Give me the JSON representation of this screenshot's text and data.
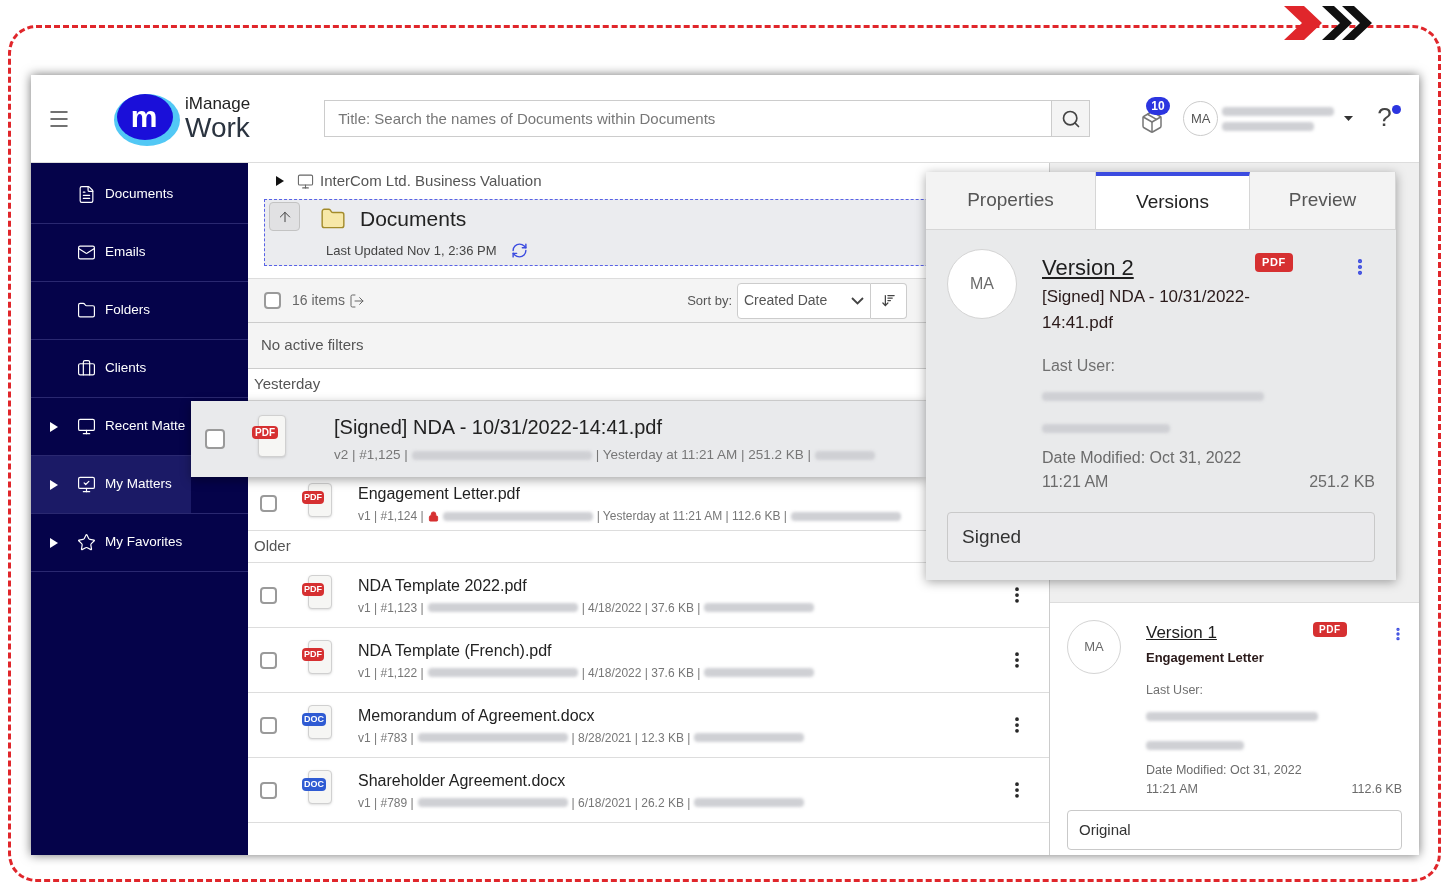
{
  "header": {
    "logo": {
      "mark": "m",
      "brand": "iManage",
      "product": "Work"
    },
    "search": {
      "placeholder": "Title: Search the names of Documents within Documents"
    },
    "notifications": "10",
    "avatar": "MA",
    "help": "?",
    "help_dot": true
  },
  "sidebar": {
    "items": [
      {
        "label": "Documents",
        "expandable": false,
        "selected": false
      },
      {
        "label": "Emails",
        "expandable": false,
        "selected": false
      },
      {
        "label": "Folders",
        "expandable": false,
        "selected": false
      },
      {
        "label": "Clients",
        "expandable": false,
        "selected": false
      },
      {
        "label": "Recent Matte",
        "expandable": true,
        "selected": false
      },
      {
        "label": "My Matters",
        "expandable": true,
        "selected": true
      },
      {
        "label": "My Favorites",
        "expandable": true,
        "selected": false
      }
    ]
  },
  "breadcrumb": "InterCom Ltd. Business Valuation",
  "folder": {
    "title": "Documents",
    "updated": "Last Updated Nov 1, 2:36 PM"
  },
  "toolbar": {
    "select_all": false,
    "count": "16 items",
    "sort_label": "Sort by:",
    "sort_value": "Created Date"
  },
  "filters": "No active filters",
  "groups": [
    {
      "title": "Yesterday",
      "rows": [
        {
          "name": "[Signed] NDA - 10/31/2022-14:41.pdf",
          "kind": "pdf",
          "badge": "PDF",
          "meta_before": "v2 | #1,125 |",
          "meta_after": "| Yesterday at 11:21 AM | 251.2 KB |",
          "locked": false,
          "checked": false,
          "dragging": true
        },
        {
          "name": "Engagement Letter.pdf",
          "kind": "pdf",
          "badge": "PDF",
          "meta_before": "v1 | #1,124 |",
          "meta_after": "| Yesterday at 11:21 AM | 112.6 KB |",
          "locked": true,
          "checked": false,
          "dragging": false
        }
      ]
    },
    {
      "title": "Older",
      "rows": [
        {
          "name": "NDA Template 2022.pdf",
          "kind": "pdf",
          "badge": "PDF",
          "meta_before": "v1 | #1,123 |",
          "meta_after": "| 4/18/2022 | 37.6 KB |",
          "locked": false,
          "checked": false,
          "dragging": false
        },
        {
          "name": "NDA Template (French).pdf",
          "kind": "pdf",
          "badge": "PDF",
          "meta_before": "v1 | #1,122 |",
          "meta_after": "| 4/18/2022 | 37.6 KB |",
          "locked": false,
          "checked": false,
          "dragging": false
        },
        {
          "name": "Memorandum of Agreement.docx",
          "kind": "doc",
          "badge": "DOC",
          "meta_before": "v1 | #783 |",
          "meta_after": "| 8/28/2021 | 12.3 KB |",
          "locked": false,
          "checked": false,
          "dragging": false
        },
        {
          "name": "Shareholder Agreement.docx",
          "kind": "doc",
          "badge": "DOC",
          "meta_before": "v1 | #789 |",
          "meta_after": "| 6/18/2021 | 26.2 KB |",
          "locked": false,
          "checked": false,
          "dragging": false
        }
      ]
    }
  ],
  "floating_card": {
    "tabs": [
      {
        "label": "Properties",
        "selected": false
      },
      {
        "label": "Versions",
        "selected": true
      },
      {
        "label": "Preview",
        "selected": false
      }
    ],
    "version": {
      "avatar": "MA",
      "title": "Version 2",
      "badge": "PDF",
      "file": "[Signed] NDA - 10/31/2022-14:41.pdf",
      "last_user_label": "Last User:",
      "modified": "Date Modified: Oct 31, 2022",
      "time": "11:21 AM",
      "size": "251.2 KB",
      "comment": "Signed"
    }
  },
  "side_panel": {
    "version": {
      "avatar": "MA",
      "title": "Version 1",
      "badge": "PDF",
      "file": "Engagement Letter",
      "last_user_label": "Last User:",
      "modified": "Date Modified: Oct 31, 2022",
      "time": "11:21 AM",
      "size": "112.6 KB",
      "comment": "Original"
    }
  }
}
